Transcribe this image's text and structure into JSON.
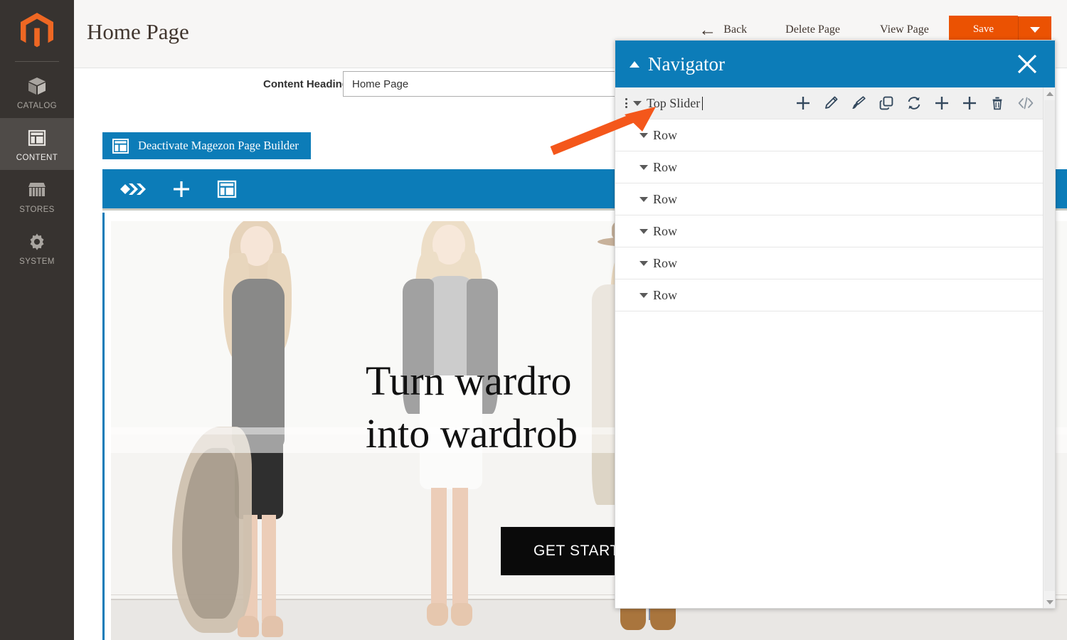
{
  "sidebar": {
    "logo_name": "magento-logo",
    "items": [
      {
        "label": "CATALOG",
        "icon": "box-icon",
        "active": false
      },
      {
        "label": "CONTENT",
        "icon": "layout-icon",
        "active": true
      },
      {
        "label": "STORES",
        "icon": "store-icon",
        "active": false
      },
      {
        "label": "SYSTEM",
        "icon": "gear-icon",
        "active": false
      }
    ]
  },
  "header": {
    "title": "Home Page",
    "back_label": "Back",
    "delete_label": "Delete Page",
    "view_label": "View Page",
    "save_label": "Save",
    "save_accent_color": "#eb5202"
  },
  "form": {
    "content_heading_label": "Content Heading",
    "content_heading_value": "Home Page",
    "content_heading_placeholder": "Content Heading"
  },
  "page_builder": {
    "deactivate_label": "Deactivate Magezon Page Builder",
    "accent_color": "#0c7cb8",
    "toolbar": [
      {
        "name": "chevrons-icon"
      },
      {
        "name": "plus-icon"
      },
      {
        "name": "layout-icon"
      }
    ],
    "hero": {
      "line1": "Turn wardro",
      "line2": "into wardrob",
      "cta_label": "GET STARTED"
    }
  },
  "navigator": {
    "title": "Navigator",
    "collapse_icon": "caret-up-icon",
    "close_icon": "close-icon",
    "selected_item": "Top Slider",
    "items": [
      {
        "label": "Top Slider",
        "selected": true,
        "editing": true,
        "has_drag_handle": true,
        "tools": [
          {
            "name": "add-icon",
            "glyph": "plus"
          },
          {
            "name": "edit-icon",
            "glyph": "pencil"
          },
          {
            "name": "style-icon",
            "glyph": "brush"
          },
          {
            "name": "duplicate-icon",
            "glyph": "copy"
          },
          {
            "name": "refresh-icon",
            "glyph": "refresh"
          },
          {
            "name": "add-before-icon",
            "glyph": "plus"
          },
          {
            "name": "add-after-icon",
            "glyph": "plus"
          },
          {
            "name": "delete-icon",
            "glyph": "trash"
          },
          {
            "name": "code-icon",
            "glyph": "code"
          }
        ]
      },
      {
        "label": "Row",
        "selected": false,
        "editing": false,
        "has_drag_handle": false,
        "tools": []
      },
      {
        "label": "Row",
        "selected": false,
        "editing": false,
        "has_drag_handle": false,
        "tools": []
      },
      {
        "label": "Row",
        "selected": false,
        "editing": false,
        "has_drag_handle": false,
        "tools": []
      },
      {
        "label": "Row",
        "selected": false,
        "editing": false,
        "has_drag_handle": false,
        "tools": []
      },
      {
        "label": "Row",
        "selected": false,
        "editing": false,
        "has_drag_handle": false,
        "tools": []
      },
      {
        "label": "Row",
        "selected": false,
        "editing": false,
        "has_drag_handle": false,
        "tools": []
      }
    ],
    "scrollbar": {
      "up_icon": "scroll-up-icon",
      "down_icon": "scroll-down-icon"
    }
  },
  "annotation": {
    "arrow_color": "#f4571b",
    "points_to": "Top Slider"
  }
}
